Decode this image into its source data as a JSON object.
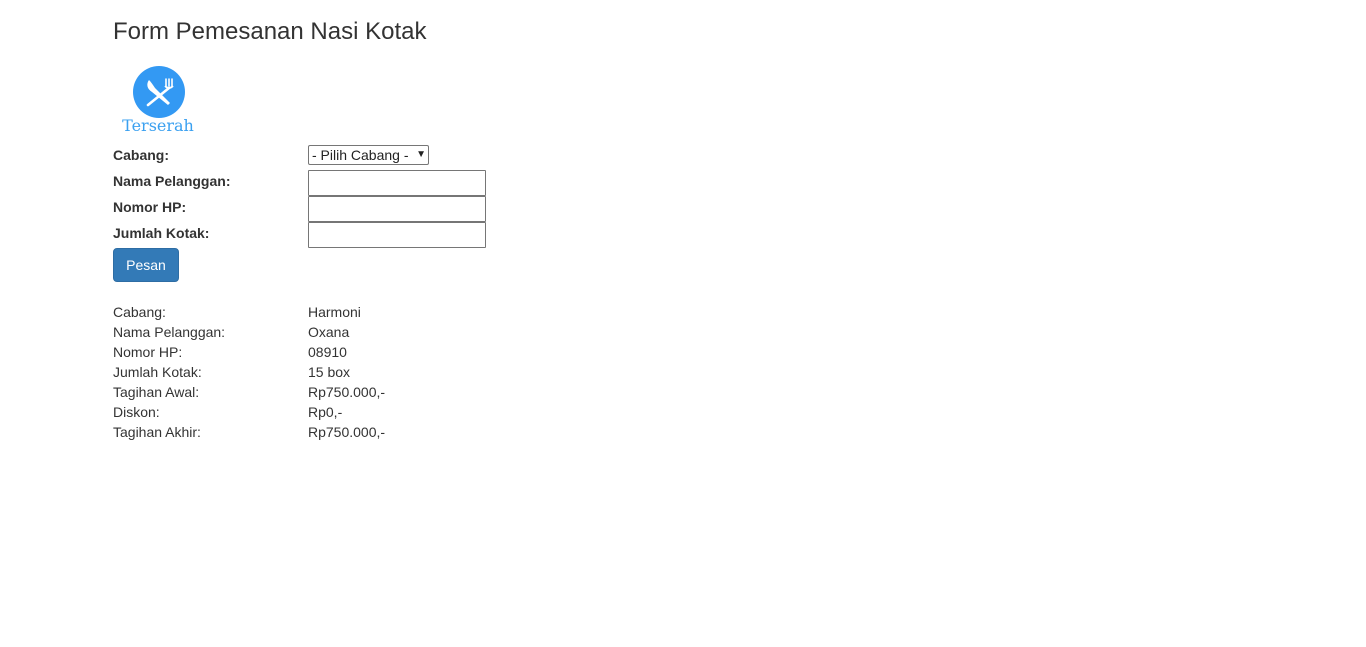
{
  "title": "Form Pemesanan Nasi Kotak",
  "logo": {
    "icon": "fork-knife-icon",
    "text": "Terserah",
    "color": "#3aa0f0"
  },
  "form": {
    "branch_label": "Cabang:",
    "branch_select_value": "- Pilih Cabang -",
    "customer_label": "Nama Pelanggan:",
    "customer_value": "",
    "phone_label": "Nomor HP:",
    "phone_value": "",
    "qty_label": "Jumlah Kotak:",
    "qty_value": "",
    "submit_label": "Pesan"
  },
  "result": {
    "rows": [
      {
        "label": "Cabang:",
        "value": "Harmoni"
      },
      {
        "label": "Nama Pelanggan:",
        "value": "Oxana"
      },
      {
        "label": "Nomor HP:",
        "value": "08910"
      },
      {
        "label": "Jumlah Kotak:",
        "value": "15 box"
      },
      {
        "label": "Tagihan Awal:",
        "value": "Rp750.000,-"
      },
      {
        "label": "Diskon:",
        "value": "Rp0,-"
      },
      {
        "label": "Tagihan Akhir:",
        "value": "Rp750.000,-"
      }
    ]
  },
  "colors": {
    "primary_button": "#337ab7",
    "text": "#333333"
  }
}
